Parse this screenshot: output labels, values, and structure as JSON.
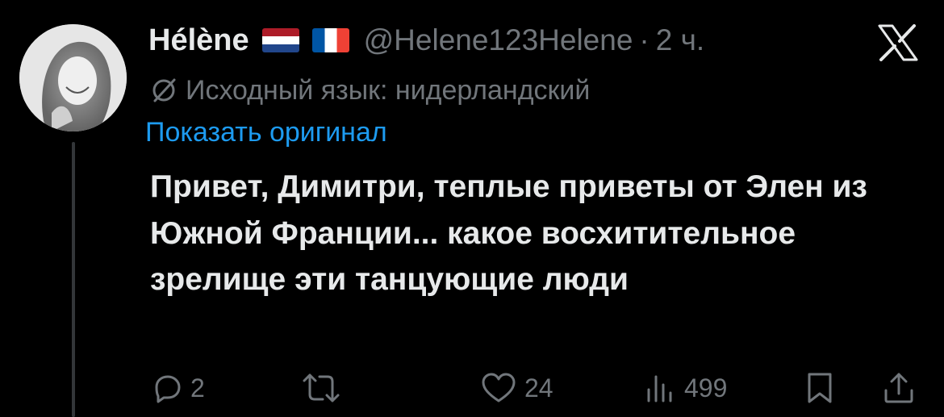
{
  "author": {
    "display_name": "Hélène",
    "flags": [
      "netherlands-flag",
      "france-flag"
    ],
    "handle": "@Helene123Helene",
    "separator": "·",
    "timestamp": "2 ч."
  },
  "translation": {
    "notice": "Исходный язык: нидерландский",
    "show_original_label": "Показать оригинал"
  },
  "tweet": {
    "text": "Привет, Димитри, теплые приветы от Элен из Южной Франции... какое восхитительное зрелище эти танцующие люди"
  },
  "actions": {
    "reply_count": "2",
    "repost_count": "",
    "like_count": "24",
    "views_count": "499"
  },
  "icons": {
    "reply": "reply-icon",
    "repost": "repost-icon",
    "like": "like-icon",
    "views": "views-icon",
    "bookmark": "bookmark-icon",
    "share": "share-icon",
    "logo": "x-logo-icon",
    "translate": "translate-icon"
  },
  "colors": {
    "background": "#000000",
    "primary_text": "#e7e9ea",
    "secondary_text": "#71767b",
    "link": "#1d9bf0",
    "thread_line": "#333639"
  }
}
